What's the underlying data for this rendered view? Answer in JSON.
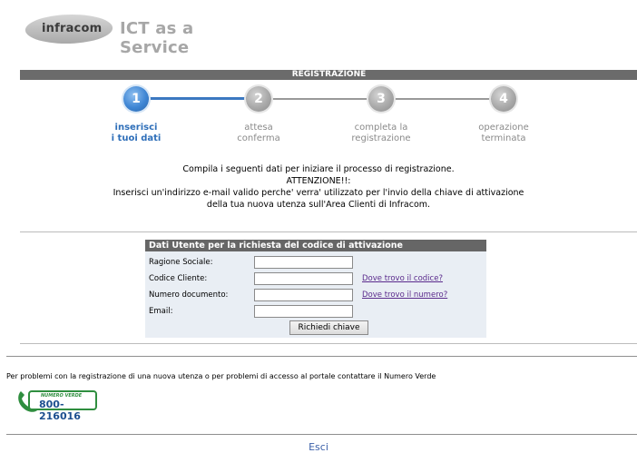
{
  "header": {
    "logo_text": "infracom",
    "tagline": "ICT as a Service"
  },
  "registration": {
    "bar_title": "REGISTRAZIONE",
    "steps": [
      {
        "number": "1",
        "label_line1": "inserisci",
        "label_line2": "i tuoi dati",
        "active": true
      },
      {
        "number": "2",
        "label_line1": "attesa",
        "label_line2": "conferma",
        "active": false
      },
      {
        "number": "3",
        "label_line1": "completa la",
        "label_line2": "registrazione",
        "active": false
      },
      {
        "number": "4",
        "label_line1": "operazione",
        "label_line2": "terminata",
        "active": false
      }
    ],
    "intro": {
      "line1": "Compila i seguenti dati per iniziare il processo di registrazione.",
      "line2": "ATTENZIONE!!:",
      "line3": "Inserisci un'indirizzo e-mail valido perche' verra' utilizzato per l'invio della chiave di attivazione",
      "line4": "della tua nuova utenza sull'Area Clienti di Infracom."
    }
  },
  "form": {
    "title": "Dati Utente per la richiesta del codice di attivazione",
    "fields": [
      {
        "label": "Ragione Sociale:",
        "value": "",
        "link": ""
      },
      {
        "label": "Codice Cliente:",
        "value": "",
        "link": "Dove trovo il codice?"
      },
      {
        "label": "Numero documento:",
        "value": "",
        "link": "Dove trovo il numero?"
      },
      {
        "label": "Email:",
        "value": "",
        "link": ""
      }
    ],
    "submit_label": "Richiedi chiave"
  },
  "footer": {
    "help_text": "Per problemi con la registrazione di una nuova utenza o per problemi di accesso al portale contattare il Numero Verde",
    "numero_verde_caption": "NUMERO VERDE",
    "numero_verde_number": "800-216016",
    "logout_label": "Esci"
  },
  "colors": {
    "accent_blue": "#3b78c1",
    "bar_gray": "#6b6b6b",
    "link_purple": "#5a2a8c",
    "numero_verde_green": "#2f8e3f"
  }
}
